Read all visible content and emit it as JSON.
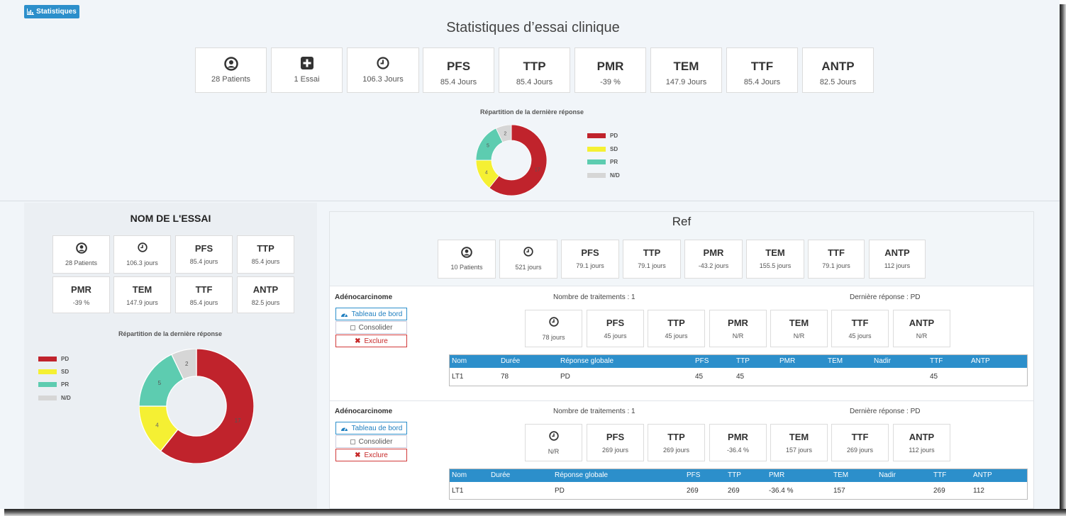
{
  "header": {
    "stats_button": "Statistiques",
    "title": "Statistiques d’essai clinique"
  },
  "summary": {
    "patients": "28 Patients",
    "essai": "1 Essai",
    "duration": "106.3 Jours",
    "metrics": [
      {
        "name": "PFS",
        "value": "85.4 Jours"
      },
      {
        "name": "TTP",
        "value": "85.4 Jours"
      },
      {
        "name": "PMR",
        "value": "-39 %"
      },
      {
        "name": "TEM",
        "value": "147.9 Jours"
      },
      {
        "name": "TTF",
        "value": "85.4 Jours"
      },
      {
        "name": "ANTP",
        "value": "82.5 Jours"
      }
    ]
  },
  "chart_data": [
    {
      "type": "pie",
      "title": "Répartition de la dernière réponse",
      "categories": [
        "PD",
        "SD",
        "PR",
        "N/D"
      ],
      "values": [
        17,
        4,
        5,
        2
      ],
      "colors": [
        "#c0232c",
        "#f5f033",
        "#5dccb0",
        "#d6d6d6"
      ],
      "legend": "right"
    },
    {
      "type": "pie",
      "title": "Répartition de la dernière réponse",
      "categories": [
        "PD",
        "SD",
        "PR",
        "N/D"
      ],
      "values": [
        17,
        4,
        5,
        2
      ],
      "colors": [
        "#c0232c",
        "#f5f033",
        "#5dccb0",
        "#d6d6d6"
      ],
      "legend": "left"
    }
  ],
  "trial": {
    "title": "NOM DE L'ESSAI",
    "patients": "28 Patients",
    "duration": "106.3 jours",
    "metrics": [
      {
        "name": "PFS",
        "value": "85.4 jours"
      },
      {
        "name": "TTP",
        "value": "85.4 jours"
      },
      {
        "name": "PMR",
        "value": "-39 %"
      },
      {
        "name": "TEM",
        "value": "147.9 jours"
      },
      {
        "name": "TTF",
        "value": "85.4 jours"
      },
      {
        "name": "ANTP",
        "value": "82.5 jours"
      }
    ]
  },
  "ref": {
    "title": "Ref",
    "patients": "10 Patients",
    "duration": "521 jours",
    "metrics": [
      {
        "name": "PFS",
        "value": "79.1 jours"
      },
      {
        "name": "TTP",
        "value": "79.1 jours"
      },
      {
        "name": "PMR",
        "value": "-43.2 jours"
      },
      {
        "name": "TEM",
        "value": "155.5 jours"
      },
      {
        "name": "TTF",
        "value": "79.1 jours"
      },
      {
        "name": "ANTP",
        "value": "112 jours"
      }
    ]
  },
  "actions": {
    "dashboard": "Tableau de bord",
    "consolidate": "Consolider",
    "exclude": "Exclure"
  },
  "table_headers": [
    "Nom",
    "Durée",
    "Réponse globale",
    "PFS",
    "TTP",
    "PMR",
    "TEM",
    "Nadir",
    "TTF",
    "ANTP"
  ],
  "patients": [
    {
      "diagnosis": "Adénocarcinome",
      "treatments": "Nombre de traitements : 1",
      "last_response": "Dernière réponse : PD",
      "duration": "78 jours",
      "metrics": [
        {
          "name": "PFS",
          "value": "45 jours"
        },
        {
          "name": "TTP",
          "value": "45 jours"
        },
        {
          "name": "PMR",
          "value": "N/R"
        },
        {
          "name": "TEM",
          "value": "N/R"
        },
        {
          "name": "TTF",
          "value": "45 jours"
        },
        {
          "name": "ANTP",
          "value": "N/R"
        }
      ],
      "row": [
        "LT1",
        "78",
        "PD",
        "45",
        "45",
        "",
        "",
        "",
        "45",
        ""
      ]
    },
    {
      "diagnosis": "Adénocarcinome",
      "treatments": "Nombre de traitements : 1",
      "last_response": "Dernière réponse : PD",
      "duration": "N/R",
      "metrics": [
        {
          "name": "PFS",
          "value": "269 jours"
        },
        {
          "name": "TTP",
          "value": "269 jours"
        },
        {
          "name": "PMR",
          "value": "-36.4 %"
        },
        {
          "name": "TEM",
          "value": "157 jours"
        },
        {
          "name": "TTF",
          "value": "269 jours"
        },
        {
          "name": "ANTP",
          "value": "112 jours"
        }
      ],
      "row": [
        "LT1",
        "",
        "PD",
        "269",
        "269",
        "-36.4 %",
        "157",
        "",
        "269",
        "112"
      ]
    }
  ]
}
